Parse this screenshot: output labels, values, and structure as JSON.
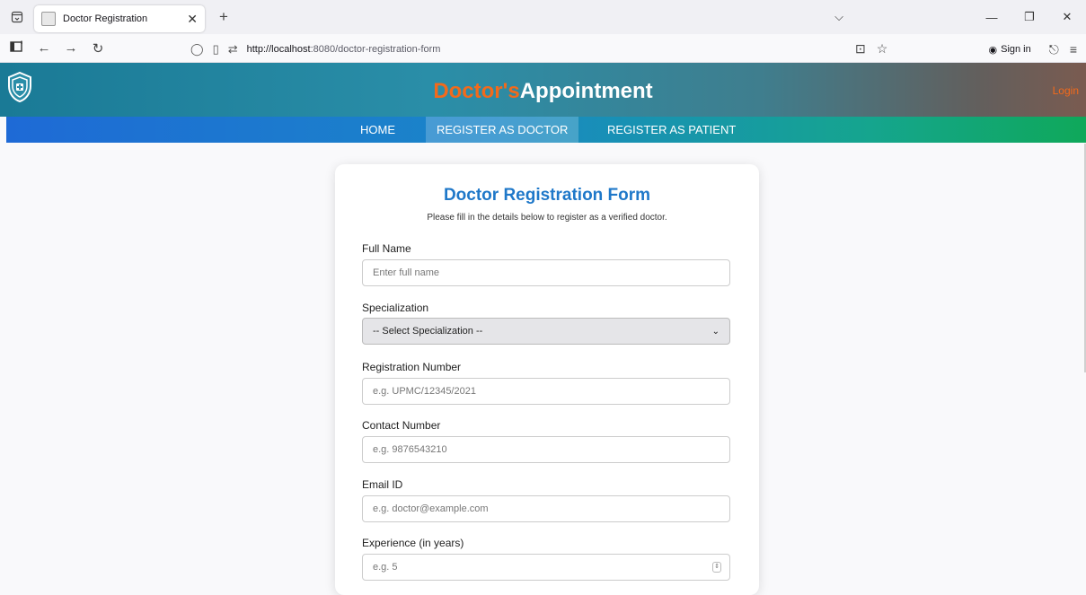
{
  "browser": {
    "tab_title": "Doctor Registration",
    "url_host": "http://localhost",
    "url_path": ":8080/doctor-registration-form",
    "sign_in": "Sign in"
  },
  "site": {
    "brand_part1": "Doctor's",
    "brand_part2": "Appointment",
    "login": "Login",
    "menu": [
      "HOME",
      "REGISTER AS DOCTOR",
      "REGISTER AS PATIENT"
    ],
    "active_menu": "REGISTER AS DOCTOR",
    "colors": {
      "brand_orange": "#f26a1b",
      "title_blue": "#1f78c9"
    }
  },
  "form": {
    "title": "Doctor Registration Form",
    "subtitle": "Please fill in the details below to register as a verified doctor.",
    "full_name": {
      "label": "Full Name",
      "placeholder": "Enter full name"
    },
    "specialization": {
      "label": "Specialization",
      "selected": "-- Select Specialization --"
    },
    "registration_number": {
      "label": "Registration Number",
      "placeholder": "e.g. UPMC/12345/2021"
    },
    "contact_number": {
      "label": "Contact Number",
      "placeholder": "e.g. 9876543210"
    },
    "email": {
      "label": "Email ID",
      "placeholder": "e.g. doctor@example.com"
    },
    "experience": {
      "label": "Experience (in years)",
      "placeholder": "e.g. 5"
    }
  }
}
